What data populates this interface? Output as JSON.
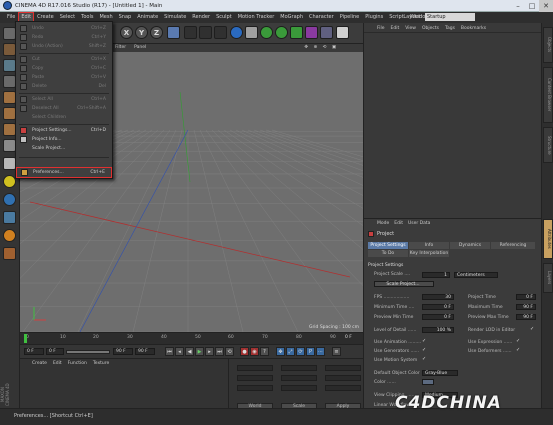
{
  "window": {
    "title": "CINEMA 4D R17.016 Studio (R17) - [Untitled 1] - Main"
  },
  "menubar": {
    "items": [
      "File",
      "Edit",
      "Create",
      "Select",
      "Tools",
      "Mesh",
      "Snap",
      "Animate",
      "Simulate",
      "Render",
      "Sculpt",
      "Motion Tracker",
      "MoGraph",
      "Character",
      "Pipeline",
      "Plugins",
      "Script",
      "Window",
      "Help"
    ],
    "layout_label": "Layout:",
    "layout_value": "Startup"
  },
  "edit_menu": {
    "items": [
      {
        "label": "Undo",
        "shortcut": "Ctrl+Z",
        "disabled": true
      },
      {
        "label": "Redo",
        "shortcut": "Ctrl+Y",
        "disabled": true
      },
      {
        "label": "Undo (Action)",
        "shortcut": "Shift+Z",
        "disabled": true
      },
      {
        "label": "Cut",
        "shortcut": "Ctrl+X",
        "disabled": true
      },
      {
        "label": "Copy",
        "shortcut": "Ctrl+C",
        "disabled": true
      },
      {
        "label": "Paste",
        "shortcut": "Ctrl+V",
        "disabled": true
      },
      {
        "label": "Delete",
        "shortcut": "Del",
        "disabled": true
      },
      {
        "label": "Select All",
        "shortcut": "Ctrl+A",
        "disabled": true
      },
      {
        "label": "Deselect All",
        "shortcut": "Ctrl+Shift+A",
        "disabled": true
      },
      {
        "label": "Select Children",
        "shortcut": "",
        "disabled": true
      },
      {
        "label": "Project Settings...",
        "shortcut": "Ctrl+D",
        "disabled": false
      },
      {
        "label": "Project Info...",
        "shortcut": "",
        "disabled": false
      },
      {
        "label": "Scale Project...",
        "shortcut": "",
        "disabled": false
      },
      {
        "label": "Preferences...",
        "shortcut": "Ctrl+E",
        "disabled": false
      }
    ]
  },
  "viewport": {
    "menu": [
      "Filter",
      "Panel"
    ],
    "grid_spacing": "Grid Spacing : 100 cm"
  },
  "timeline": {
    "ticks": [
      "0",
      "10",
      "20",
      "30",
      "40",
      "50",
      "60",
      "70",
      "80",
      "90"
    ],
    "frame_end": "0 F"
  },
  "playbar": {
    "start": "0 F",
    "min": "0 F",
    "max": "90 F",
    "end": "90 F"
  },
  "material_manager": {
    "menu": [
      "Create",
      "Edit",
      "Function",
      "Texture"
    ],
    "brand": "MAXON CINEMA 4D"
  },
  "coordinates": {
    "buttons": [
      "World",
      "Scale",
      "Apply"
    ]
  },
  "statusbar": {
    "text": "Preferences... [Shortcut Ctrl+E]"
  },
  "object_manager": {
    "menu": [
      "File",
      "Edit",
      "View",
      "Objects",
      "Tags",
      "Bookmarks"
    ]
  },
  "attribute_manager": {
    "menu": [
      "Mode",
      "Edit",
      "User Data"
    ],
    "title": "Project",
    "tabs_row1": [
      "Project Settings",
      "Info",
      "Dynamics",
      "Referencing"
    ],
    "tabs_row2": [
      "To Do",
      "Key Interpolation"
    ],
    "section": "Project Settings",
    "project_scale_label": "Project Scale ....",
    "project_scale_value": "1",
    "project_scale_unit": "Centimeters",
    "scale_button": "Scale Project...",
    "left_fields": [
      {
        "label": "FPS ..................",
        "value": "30"
      },
      {
        "label": "Minimum Time ....",
        "value": "0 F"
      },
      {
        "label": "Preview Min Time",
        "value": "0 F"
      },
      {
        "label": "Level of Detail ......",
        "value": "100 %"
      }
    ],
    "right_fields": [
      {
        "label": "Project Time",
        "value": "0 F"
      },
      {
        "label": "Maximum Time",
        "value": "90 F"
      },
      {
        "label": "Preview Max Time",
        "value": "90 F"
      }
    ],
    "render_lod": "Render LOD in Editor",
    "checks_left": [
      "Use Animation .........",
      "Use Generators ......",
      "Use Motion System"
    ],
    "checks_right": [
      "Use Expression ......",
      "Use Deformers ......"
    ],
    "default_color_label": "Default Object Color",
    "default_color_value": "Gray-Blue",
    "color_label": "Color ......",
    "view_clipping_label": "View Clipping ........",
    "view_clipping_value": "Medium",
    "linear_workflow_label": "Linear Workflow"
  },
  "right_tabs": [
    "Objects",
    "Content Browser",
    "Structure",
    "Attributes",
    "Layers"
  ],
  "watermark": "C4DCHINA",
  "colors": {
    "accent": "#5b7aa6",
    "highlight_border": "#e03030",
    "viewport_bg": "#6e6e6e"
  }
}
